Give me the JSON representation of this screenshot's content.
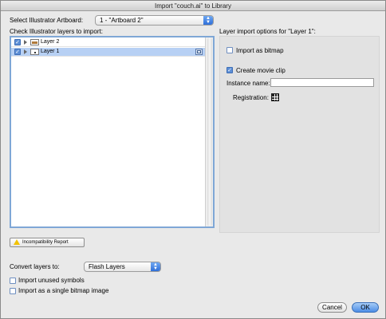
{
  "window": {
    "title": "Import \"couch.ai\" to Library"
  },
  "artboard": {
    "label": "Select Illustrator Artboard:",
    "value": "1 - \"Artboard 2\""
  },
  "layers": {
    "label": "Check Illustrator layers to import:",
    "rows": [
      {
        "name": "Layer 2",
        "checked": true,
        "selected": false
      },
      {
        "name": "Layer 1",
        "checked": true,
        "selected": true
      }
    ]
  },
  "options": {
    "header": "Layer import options for \"Layer 1\":",
    "import_bitmap": {
      "label": "Import as bitmap",
      "checked": false
    },
    "create_clip": {
      "label": "Create movie clip",
      "checked": true
    },
    "instance_name": {
      "label": "Instance name:",
      "value": ""
    },
    "registration": {
      "label": "Registration:"
    }
  },
  "incompat_button": "Incompatibility Report",
  "convert": {
    "label": "Convert layers to:",
    "value": "Flash Layers"
  },
  "import_unused": {
    "label": "Import unused symbols",
    "checked": false
  },
  "import_single": {
    "label": "Import as a single bitmap image",
    "checked": false
  },
  "buttons": {
    "cancel": "Cancel",
    "ok": "OK"
  },
  "colors": {
    "accent": "#4c8de6",
    "selection": "#b7d0f4"
  }
}
